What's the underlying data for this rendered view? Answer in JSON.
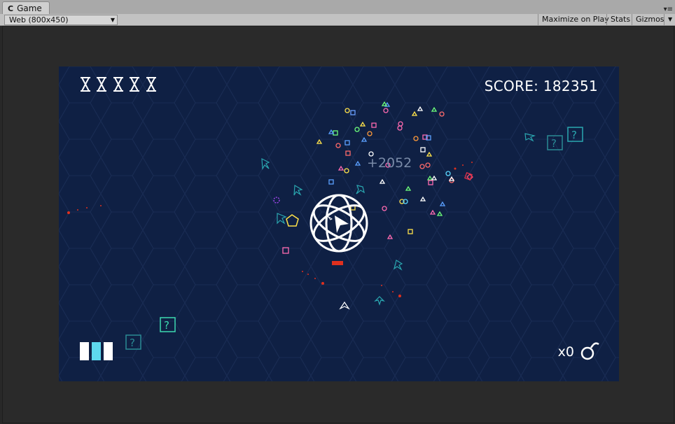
{
  "editor": {
    "tab_label": "Game",
    "resolution": "Web (800x450)",
    "buttons": [
      "Maximize on Play",
      "Stats",
      "Gizmos"
    ]
  },
  "hud": {
    "lives": 5,
    "score": "SCORE: 182351",
    "popup": "+2052",
    "bombs": "x0",
    "energy_bars": [
      "#ffffff",
      "#5ed8ee",
      "#ffffff"
    ]
  },
  "colors": {
    "background": "#0f2044",
    "mystery_box": "#3dd9b0",
    "enemy_outline": "#2aa7b0",
    "accent_red": "#e0301e"
  },
  "icons": [
    "hourglass-icon",
    "bomb-icon",
    "question-mark-icon",
    "player-ship-icon",
    "shield-orb-icon"
  ]
}
